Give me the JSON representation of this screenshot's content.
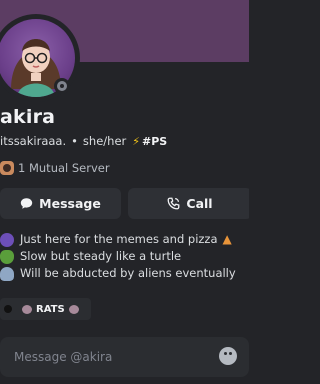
{
  "profile": {
    "display_name": "akira",
    "username": "itssakiraaa.",
    "separator": "•",
    "pronouns": "she/her",
    "badge_label": "#PS",
    "status": "offline"
  },
  "mutual": {
    "label": "1 Mutual Server"
  },
  "actions": {
    "message_label": "Message",
    "call_label": "Call"
  },
  "bio": {
    "lines": [
      "Just here for the memes and pizza",
      "Slow but steady like a turtle",
      "Will be abducted by aliens eventually"
    ]
  },
  "role_tag": {
    "label": "RATS"
  },
  "message_input": {
    "placeholder": "Message @akira"
  },
  "colors": {
    "banner": "#5c3d63",
    "background": "#232428",
    "button": "#2e3035"
  },
  "icons": [
    "message-icon",
    "phone-icon",
    "emoji-icon",
    "lightning-icon"
  ]
}
